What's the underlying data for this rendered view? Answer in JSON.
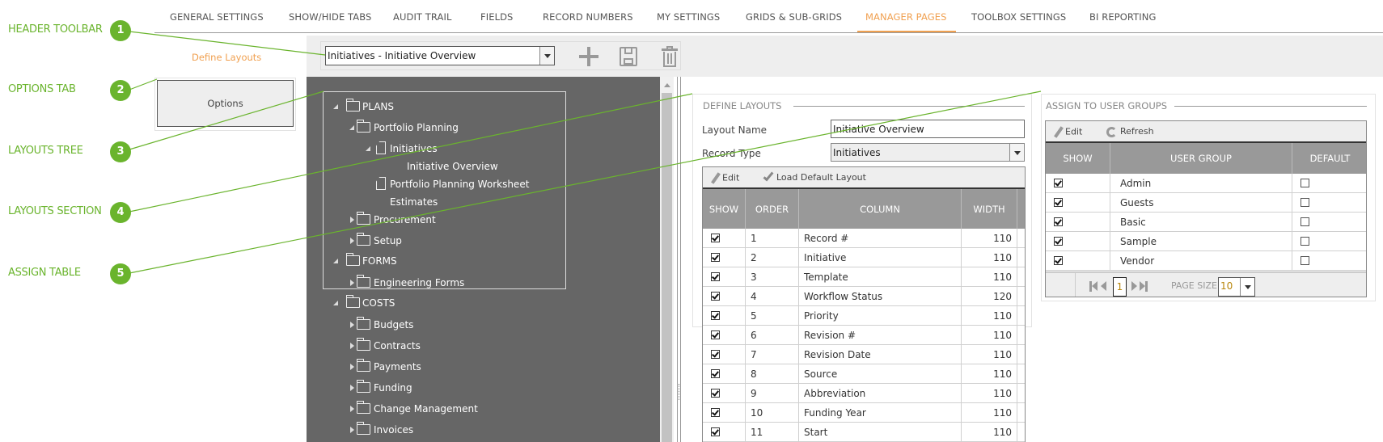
{
  "tabs": [
    {
      "label": "GENERAL SETTINGS"
    },
    {
      "label": "SHOW/HIDE TABS"
    },
    {
      "label": "AUDIT TRAIL"
    },
    {
      "label": "FIELDS"
    },
    {
      "label": "RECORD NUMBERS"
    },
    {
      "label": "MY SETTINGS"
    },
    {
      "label": "GRIDS & SUB-GRIDS"
    },
    {
      "label": "MANAGER PAGES",
      "active": true
    },
    {
      "label": "TOOLBOX SETTINGS"
    },
    {
      "label": "BI REPORTING"
    }
  ],
  "annotations": [
    {
      "number": "1",
      "label": "HEADER TOOLBAR"
    },
    {
      "number": "2",
      "label": "OPTIONS TAB"
    },
    {
      "number": "3",
      "label": "LAYOUTS TREE"
    },
    {
      "number": "4",
      "label": "LAYOUTS SECTION"
    },
    {
      "number": "5",
      "label": "ASSIGN TABLE"
    }
  ],
  "colors": {
    "accent": "#f0a050",
    "annotation": "#6ab42d",
    "tree_bg": "#666666",
    "grid_header": "#999999"
  },
  "sidebar": {
    "define_layouts": "Define Layouts",
    "options": "Options"
  },
  "toolbar": {
    "layout_select": "Initiatives - Initiative Overview",
    "icons": [
      "plus-icon",
      "save-icon",
      "trash-icon"
    ]
  },
  "tree": [
    {
      "label": "PLANS",
      "level": 0,
      "type": "folder",
      "state": "open"
    },
    {
      "label": "Portfolio Planning",
      "level": 1,
      "type": "folder",
      "state": "open"
    },
    {
      "label": "Initiatives",
      "level": 2,
      "type": "doc",
      "state": "open"
    },
    {
      "label": "Initiative Overview",
      "level": 3,
      "type": "leaf"
    },
    {
      "label": "Portfolio Planning Worksheet",
      "level": 2,
      "type": "doc",
      "state": "none"
    },
    {
      "label": "Estimates",
      "level": 2,
      "type": "leaf"
    },
    {
      "label": "Procurement",
      "level": 1,
      "type": "folder",
      "state": "closed"
    },
    {
      "label": "Setup",
      "level": 1,
      "type": "folder",
      "state": "closed"
    },
    {
      "label": "FORMS",
      "level": 0,
      "type": "folder",
      "state": "open"
    },
    {
      "label": "Engineering Forms",
      "level": 1,
      "type": "folder",
      "state": "closed"
    },
    {
      "label": "COSTS",
      "level": 0,
      "type": "folder",
      "state": "open"
    },
    {
      "label": "Budgets",
      "level": 1,
      "type": "folder",
      "state": "closed"
    },
    {
      "label": "Contracts",
      "level": 1,
      "type": "folder",
      "state": "closed"
    },
    {
      "label": "Payments",
      "level": 1,
      "type": "folder",
      "state": "closed"
    },
    {
      "label": "Funding",
      "level": 1,
      "type": "folder",
      "state": "closed"
    },
    {
      "label": "Change Management",
      "level": 1,
      "type": "folder",
      "state": "closed"
    },
    {
      "label": "Invoices",
      "level": 1,
      "type": "folder",
      "state": "closed"
    }
  ],
  "define": {
    "title": "DEFINE LAYOUTS",
    "layout_name_label": "Layout Name",
    "layout_name_value": "Initiative Overview",
    "record_type_label": "Record Type",
    "record_type_value": "Initiatives",
    "edit": "Edit",
    "load_default": "Load Default Layout",
    "headers": [
      "SHOW",
      "ORDER",
      "COLUMN",
      "WIDTH"
    ],
    "rows": [
      {
        "show": true,
        "order": "1",
        "column": "Record #",
        "width": "110"
      },
      {
        "show": true,
        "order": "2",
        "column": "Initiative",
        "width": "110"
      },
      {
        "show": true,
        "order": "3",
        "column": "Template",
        "width": "110"
      },
      {
        "show": true,
        "order": "4",
        "column": "Workflow Status",
        "width": "120"
      },
      {
        "show": true,
        "order": "5",
        "column": "Priority",
        "width": "110"
      },
      {
        "show": true,
        "order": "6",
        "column": "Revision #",
        "width": "110"
      },
      {
        "show": true,
        "order": "7",
        "column": "Revision Date",
        "width": "110"
      },
      {
        "show": true,
        "order": "8",
        "column": "Source",
        "width": "110"
      },
      {
        "show": true,
        "order": "9",
        "column": "Abbreviation",
        "width": "110"
      },
      {
        "show": true,
        "order": "10",
        "column": "Funding Year",
        "width": "110"
      },
      {
        "show": true,
        "order": "11",
        "column": "Start",
        "width": "110"
      }
    ]
  },
  "assign": {
    "title": "ASSIGN TO USER GROUPS",
    "edit": "Edit",
    "refresh": "Refresh",
    "headers": [
      "SHOW",
      "USER GROUP",
      "DEFAULT"
    ],
    "rows": [
      {
        "show": true,
        "group": "Admin",
        "default": false
      },
      {
        "show": true,
        "group": "Guests",
        "default": false
      },
      {
        "show": true,
        "group": "Basic",
        "default": false
      },
      {
        "show": true,
        "group": "Sample",
        "default": false
      },
      {
        "show": true,
        "group": "Vendor",
        "default": false
      }
    ],
    "pager": {
      "page": "1",
      "page_size_label": "PAGE SIZE",
      "page_size": "10"
    }
  }
}
